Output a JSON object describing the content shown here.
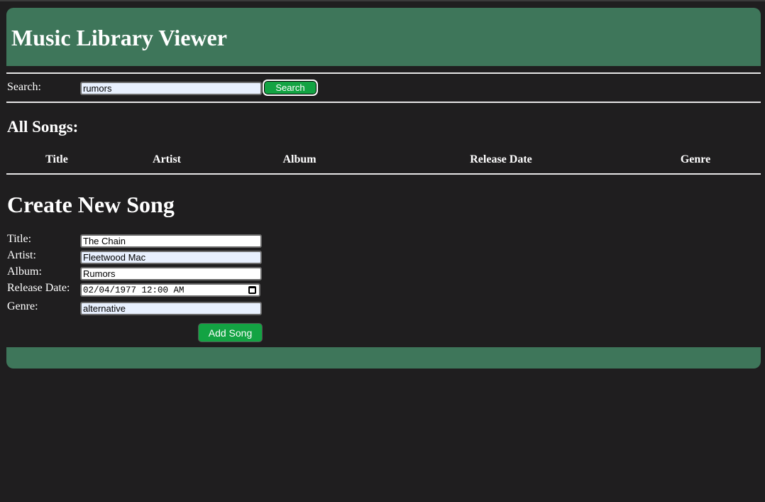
{
  "header": {
    "title": "Music Library Viewer"
  },
  "search": {
    "label": "Search:",
    "value": "rumors",
    "button_label": "Search"
  },
  "songs": {
    "heading": "All Songs:",
    "columns": [
      "Title",
      "Artist",
      "Album",
      "Release Date",
      "Genre"
    ],
    "rows": []
  },
  "create": {
    "heading": "Create New Song",
    "title_label": "Title:",
    "title_value": "The Chain",
    "artist_label": "Artist:",
    "artist_value": "Fleetwood Mac",
    "album_label": "Album:",
    "album_value": "Rumors",
    "release_label": "Release Date:",
    "release_value": "02/04/1977 12:00 AM",
    "genre_label": "Genre:",
    "genre_value": "alternative",
    "submit_label": "Add Song",
    "calendar_icon": "calendar-icon"
  },
  "colors": {
    "header_bg": "#3e765a",
    "button_bg": "#13a343",
    "page_bg": "#1f1e1f"
  }
}
